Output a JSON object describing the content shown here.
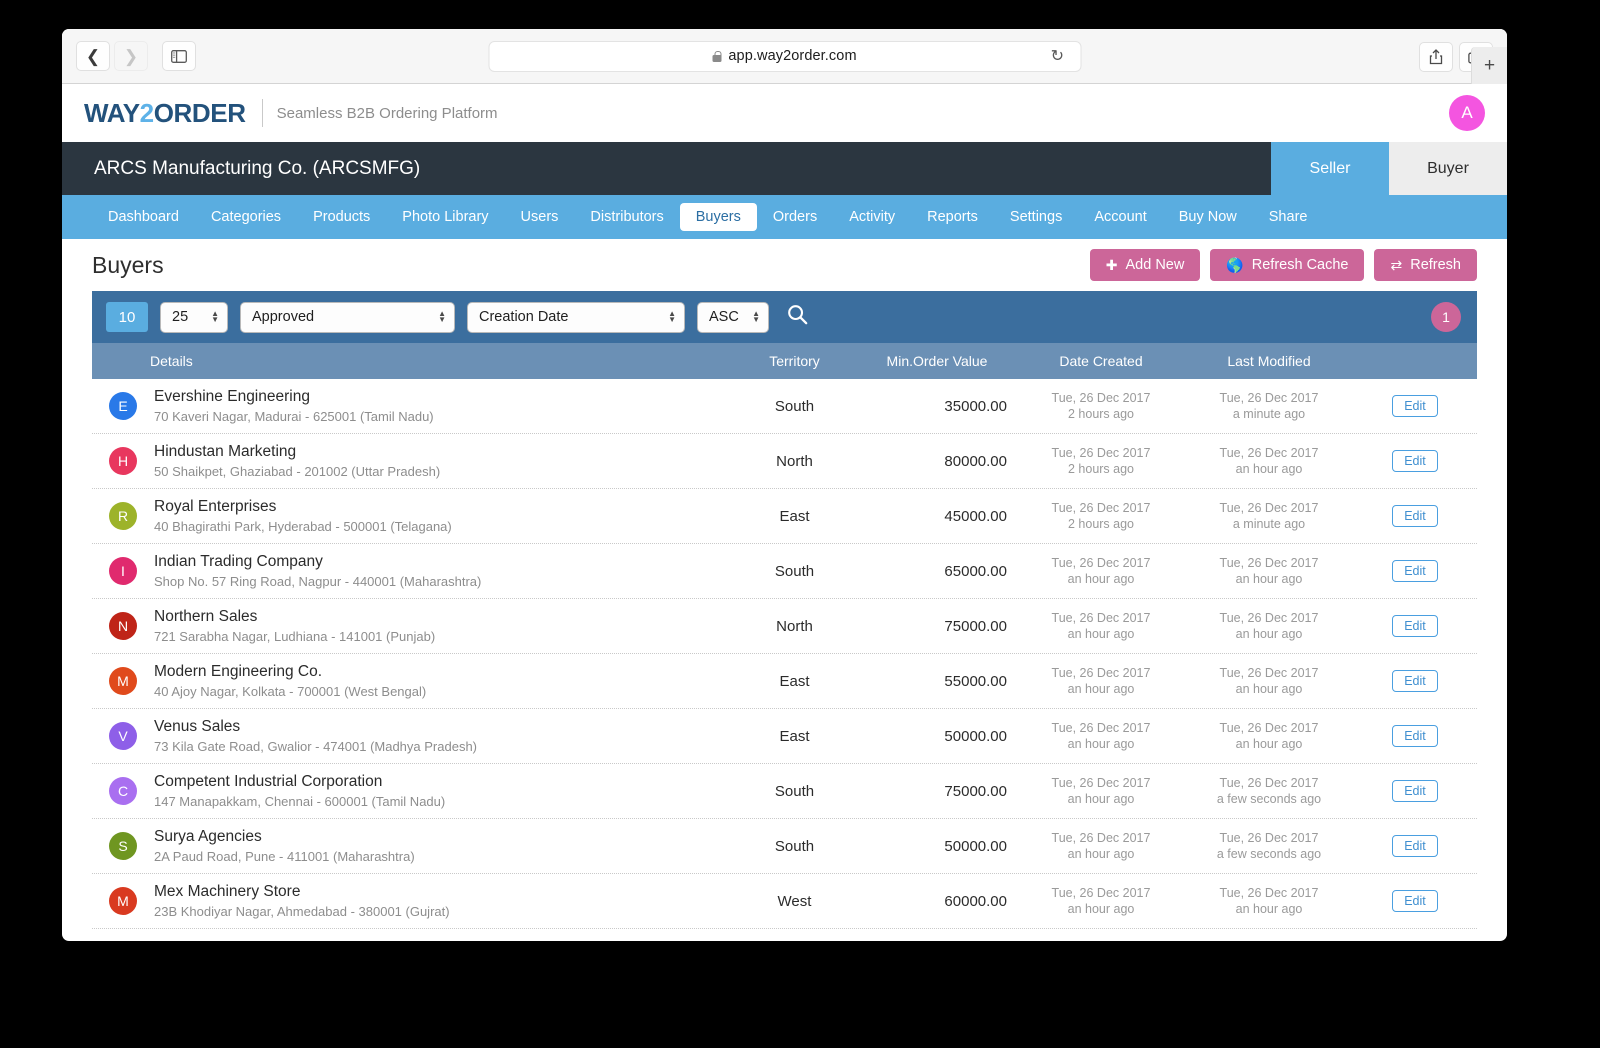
{
  "browser": {
    "back_icon": "chevron-left-icon",
    "forward_icon": "chevron-right-icon",
    "sidebar_icon": "sidebar-toggle-icon",
    "url": "app.way2order.com",
    "lock_icon": "lock-icon",
    "reload_icon": "reload-icon",
    "share_icon": "share-icon",
    "tabs_icon": "tabs-icon",
    "newtab_label": "+"
  },
  "header": {
    "logo_part1": "WAY",
    "logo_part2": "2",
    "logo_part3": "ORDER",
    "tagline": "Seamless B2B Ordering Platform",
    "avatar_initial": "A",
    "avatar_color": "#f455e0"
  },
  "company_bar": {
    "name": "ARCS Manufacturing Co. (ARCSMFG)",
    "seller_label": "Seller",
    "buyer_label": "Buyer",
    "active_mode": "Seller"
  },
  "nav": {
    "items": [
      {
        "label": "Dashboard",
        "active": false
      },
      {
        "label": "Categories",
        "active": false
      },
      {
        "label": "Products",
        "active": false
      },
      {
        "label": "Photo Library",
        "active": false
      },
      {
        "label": "Users",
        "active": false
      },
      {
        "label": "Distributors",
        "active": false
      },
      {
        "label": "Buyers",
        "active": true
      },
      {
        "label": "Orders",
        "active": false
      },
      {
        "label": "Activity",
        "active": false
      },
      {
        "label": "Reports",
        "active": false
      },
      {
        "label": "Settings",
        "active": false
      },
      {
        "label": "Account",
        "active": false
      },
      {
        "label": "Buy Now",
        "active": false
      },
      {
        "label": "Share",
        "active": false
      }
    ]
  },
  "page": {
    "title": "Buyers",
    "add_new_label": "Add New",
    "add_new_icon": "plus-icon",
    "refresh_cache_label": "Refresh Cache",
    "refresh_cache_icon": "globe-icon",
    "refresh_label": "Refresh",
    "refresh_icon": "refresh-icon",
    "button_color": "#cc6699"
  },
  "filters": {
    "count_badge": "10",
    "page_size": "25",
    "status": "Approved",
    "sort_field": "Creation Date",
    "sort_dir": "ASC",
    "search_icon": "search-icon",
    "page_badge": "1"
  },
  "table": {
    "columns": [
      "Details",
      "Territory",
      "Min.Order Value",
      "Date Created",
      "Last Modified"
    ],
    "edit_label": "Edit",
    "rows": [
      {
        "initial": "E",
        "color": "#2979e8",
        "name": "Evershine Engineering",
        "address": "70 Kaveri Nagar, Madurai - 625001 (Tamil Nadu)",
        "territory": "South",
        "min_order_value": "35000.00",
        "date_created": "Tue, 26 Dec 2017",
        "date_created_rel": "2 hours ago",
        "last_modified": "Tue, 26 Dec 2017",
        "last_modified_rel": "a minute ago"
      },
      {
        "initial": "H",
        "color": "#e8375e",
        "name": "Hindustan Marketing",
        "address": "50 Shaikpet, Ghaziabad - 201002 (Uttar Pradesh)",
        "territory": "North",
        "min_order_value": "80000.00",
        "date_created": "Tue, 26 Dec 2017",
        "date_created_rel": "2 hours ago",
        "last_modified": "Tue, 26 Dec 2017",
        "last_modified_rel": "an hour ago"
      },
      {
        "initial": "R",
        "color": "#9db32a",
        "name": "Royal Enterprises",
        "address": "40 Bhagirathi Park, Hyderabad - 500001 (Telagana)",
        "territory": "East",
        "min_order_value": "45000.00",
        "date_created": "Tue, 26 Dec 2017",
        "date_created_rel": "2 hours ago",
        "last_modified": "Tue, 26 Dec 2017",
        "last_modified_rel": "a minute ago"
      },
      {
        "initial": "I",
        "color": "#e02a6e",
        "name": "Indian Trading Company",
        "address": "Shop No. 57 Ring Road, Nagpur - 440001 (Maharashtra)",
        "territory": "South",
        "min_order_value": "65000.00",
        "date_created": "Tue, 26 Dec 2017",
        "date_created_rel": "an hour ago",
        "last_modified": "Tue, 26 Dec 2017",
        "last_modified_rel": "an hour ago"
      },
      {
        "initial": "N",
        "color": "#bf2418",
        "name": "Northern Sales",
        "address": "721 Sarabha Nagar, Ludhiana - 141001 (Punjab)",
        "territory": "North",
        "min_order_value": "75000.00",
        "date_created": "Tue, 26 Dec 2017",
        "date_created_rel": "an hour ago",
        "last_modified": "Tue, 26 Dec 2017",
        "last_modified_rel": "an hour ago"
      },
      {
        "initial": "M",
        "color": "#e04a1c",
        "name": "Modern Engineering Co.",
        "address": "40 Ajoy Nagar, Kolkata - 700001 (West Bengal)",
        "territory": "East",
        "min_order_value": "55000.00",
        "date_created": "Tue, 26 Dec 2017",
        "date_created_rel": "an hour ago",
        "last_modified": "Tue, 26 Dec 2017",
        "last_modified_rel": "an hour ago"
      },
      {
        "initial": "V",
        "color": "#8e5fe8",
        "name": "Venus Sales",
        "address": "73 Kila Gate Road, Gwalior - 474001 (Madhya Pradesh)",
        "territory": "East",
        "min_order_value": "50000.00",
        "date_created": "Tue, 26 Dec 2017",
        "date_created_rel": "an hour ago",
        "last_modified": "Tue, 26 Dec 2017",
        "last_modified_rel": "an hour ago"
      },
      {
        "initial": "C",
        "color": "#a96ff0",
        "name": "Competent Industrial Corporation",
        "address": "147 Manapakkam, Chennai - 600001 (Tamil Nadu)",
        "territory": "South",
        "min_order_value": "75000.00",
        "date_created": "Tue, 26 Dec 2017",
        "date_created_rel": "an hour ago",
        "last_modified": "Tue, 26 Dec 2017",
        "last_modified_rel": "a few seconds ago"
      },
      {
        "initial": "S",
        "color": "#6f9621",
        "name": "Surya Agencies",
        "address": "2A Paud Road, Pune - 411001 (Maharashtra)",
        "territory": "South",
        "min_order_value": "50000.00",
        "date_created": "Tue, 26 Dec 2017",
        "date_created_rel": "an hour ago",
        "last_modified": "Tue, 26 Dec 2017",
        "last_modified_rel": "a few seconds ago"
      },
      {
        "initial": "M",
        "color": "#d93a20",
        "name": "Mex Machinery Store",
        "address": "23B Khodiyar Nagar, Ahmedabad - 380001 (Gujrat)",
        "territory": "West",
        "min_order_value": "60000.00",
        "date_created": "Tue, 26 Dec 2017",
        "date_created_rel": "an hour ago",
        "last_modified": "Tue, 26 Dec 2017",
        "last_modified_rel": "an hour ago"
      }
    ]
  }
}
